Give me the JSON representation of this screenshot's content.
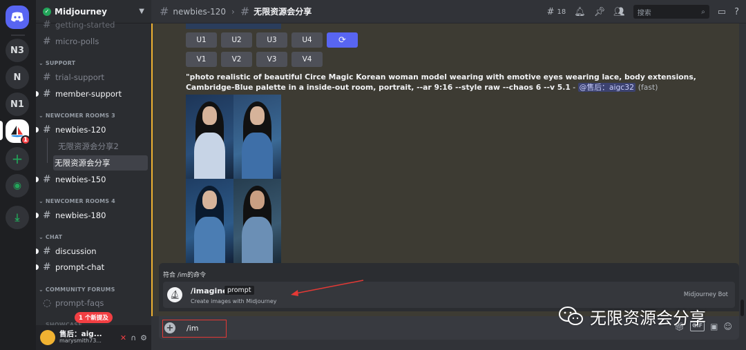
{
  "rail": {
    "servers": [
      {
        "label": "N3"
      },
      {
        "label": "N"
      },
      {
        "label": "N1"
      }
    ],
    "midjourney_badge": "1",
    "add_label": "+",
    "explore_label": "◉",
    "download_label": "⤓"
  },
  "sidebar": {
    "server_name": "Midjourney",
    "channels_top": [
      {
        "label": "getting-started"
      },
      {
        "label": "micro-polls"
      }
    ],
    "categories": {
      "support": "SUPPORT",
      "newcomer3": "NEWCOMER ROOMS 3",
      "newcomer4": "NEWCOMER ROOMS 4",
      "chat": "CHAT",
      "forums": "COMMUNITY FORUMS",
      "showcase": "SHOWCASE"
    },
    "support_channels": [
      {
        "label": "trial-support"
      },
      {
        "label": "member-support"
      }
    ],
    "newcomer3_channels": [
      {
        "label": "newbies-120"
      }
    ],
    "threads": [
      {
        "label": "无限资源会分享2"
      },
      {
        "label": "无限资源会分享"
      }
    ],
    "newbies150": "newbies-150",
    "newcomer4_channels": [
      {
        "label": "newbies-180"
      }
    ],
    "chat_channels": [
      {
        "label": "discussion"
      },
      {
        "label": "prompt-chat"
      }
    ],
    "forum_channels": [
      {
        "label": "prompt-faqs"
      }
    ],
    "new_mentions": "1 个新提及",
    "user": {
      "name": "售后：aig...",
      "tag": "marysmith73..."
    }
  },
  "topbar": {
    "channel": "newbies-120",
    "thread": "无限资源会分享",
    "thread_count": "18",
    "search_placeholder": "搜索"
  },
  "message": {
    "upscale_buttons": [
      "U1",
      "U2",
      "U3",
      "U4"
    ],
    "variation_buttons": [
      "V1",
      "V2",
      "V3",
      "V4"
    ],
    "prompt": "\"photo realistic of beautiful Circe Magic Korean woman model wearing with emotive eyes wearing lace, body extensions, Cambridge-Blue palette in a inside-out room, portrait, --ar 9:16 --style raw --chaos 6 --v 5.1",
    "dash": " - ",
    "mention": "@售后：aigc32",
    "speed": "(fast)"
  },
  "autocomplete": {
    "header": "符合 /im的命令",
    "command": "/imagine",
    "option": "prompt",
    "description": "Create images with Midjourney",
    "source": "Midjourney Bot"
  },
  "composer": {
    "value": "/im",
    "gif_label": "GIF"
  },
  "watermark": {
    "text": "无限资源会分享"
  },
  "colors": {
    "accent": "#5865f2",
    "highlight_border": "#f0b232",
    "annotation_red": "#e53935"
  }
}
